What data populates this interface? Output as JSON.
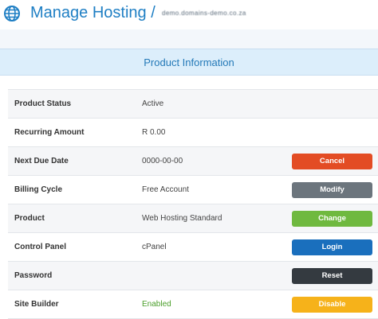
{
  "header": {
    "title": "Manage Hosting /",
    "domain": "demo.domains-demo.co.za",
    "icon": "globe-icon"
  },
  "panel": {
    "title": "Product Information"
  },
  "rows": [
    {
      "label": "Product Status",
      "value": "Active",
      "button": ""
    },
    {
      "label": "Recurring Amount",
      "value": "R 0.00",
      "button": ""
    },
    {
      "label": "Next Due Date",
      "value": "0000-00-00",
      "button": "Cancel"
    },
    {
      "label": "Billing Cycle",
      "value": "Free Account",
      "button": "Modify"
    },
    {
      "label": "Product",
      "value": "Web Hosting Standard",
      "button": "Change"
    },
    {
      "label": "Control Panel",
      "value": "cPanel",
      "button": "Login"
    },
    {
      "label": "Password",
      "value": "",
      "button": "Reset"
    },
    {
      "label": "Site Builder",
      "value": "Enabled",
      "button": "Disable"
    }
  ],
  "colors": {
    "title": "#1f7fc4",
    "panel_header_bg": "#dceefb",
    "cancel": "#e34c24",
    "modify": "#6c757d",
    "change": "#6fb93f",
    "login": "#1a6fbd",
    "reset": "#343a40",
    "disable": "#f6b21a",
    "enabled_text": "#4a9e2a"
  }
}
